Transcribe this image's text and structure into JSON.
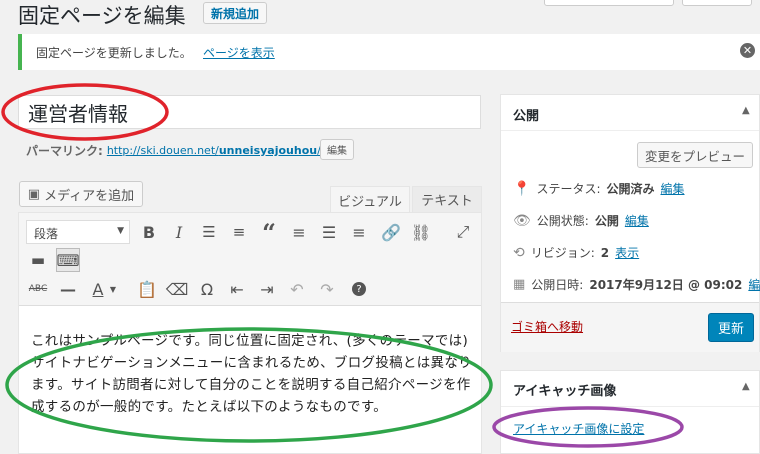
{
  "header": {
    "title": "固定ページを編集",
    "add_new": "新規追加"
  },
  "notice": {
    "text": "固定ページを更新しました。",
    "link": "ページを表示"
  },
  "post": {
    "title": "運営者情報",
    "permalink_label": "パーマリンク:",
    "permalink_base": "http://ski.douen.net/",
    "permalink_slug": "unneisyajouhou",
    "permalink_tail": "/",
    "edit_button": "編集"
  },
  "editor": {
    "add_media": "メディアを追加",
    "tabs": {
      "visual": "ビジュアル",
      "text": "テキスト"
    },
    "format_select": "段落",
    "content": "これはサンプルページです。同じ位置に固定され、(多くのテーマでは) サイトナビゲーションメニューに含まれるため、ブログ投稿とは異なります。サイト訪問者に対して自分のことを説明する自己紹介ページを作成するのが一般的です。たとえば以下のようなものです。"
  },
  "publish": {
    "title": "公開",
    "preview_button": "変更をプレビュー",
    "status_label": "ステータス:",
    "status_value": "公開済み",
    "status_edit": "編集",
    "visibility_label": "公開状態:",
    "visibility_value": "公開",
    "visibility_edit": "編集",
    "revision_label": "リビジョン:",
    "revision_value": "2",
    "revision_link": "表示",
    "date_label": "公開日時:",
    "date_value": "2017年9月12日 @ 09:02",
    "date_edit": "編集",
    "trash_link": "ゴミ箱へ移動",
    "update_button": "更新"
  },
  "featured": {
    "title": "アイキャッチ画像",
    "link": "アイキャッチ画像に設定"
  },
  "colors": {
    "accent": "#0073aa",
    "primary_button": "#0085ba",
    "annotation_red": "#e0232b",
    "annotation_green": "#2fa54a",
    "annotation_purple": "#9b48a8"
  }
}
